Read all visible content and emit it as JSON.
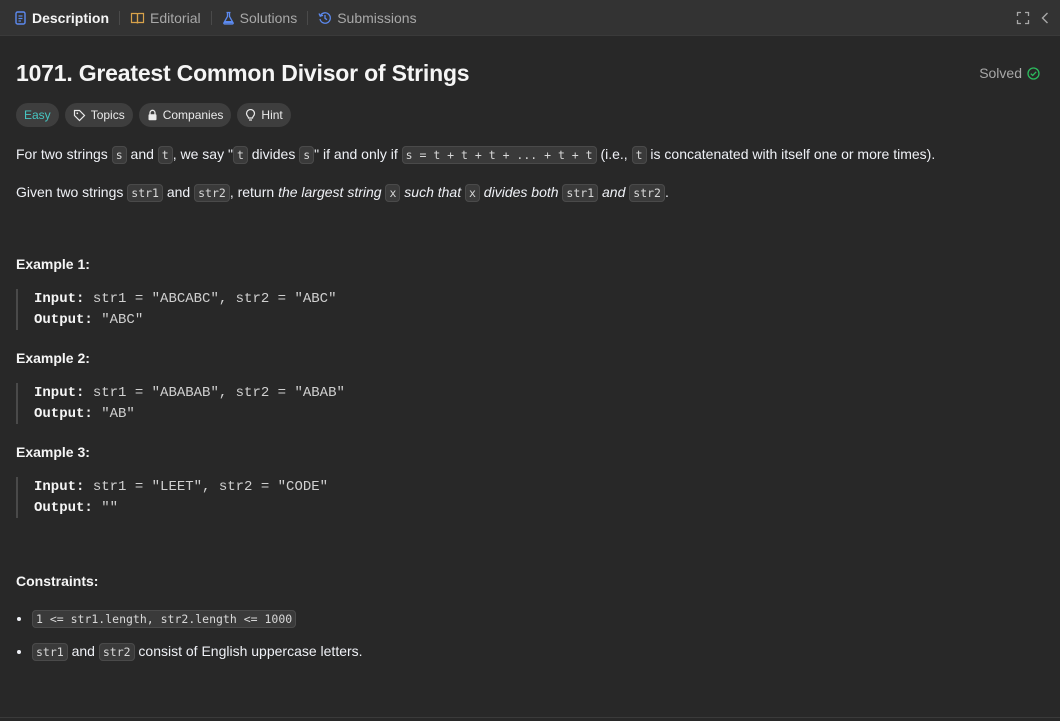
{
  "tabs": [
    {
      "label": "Description",
      "icon": "document-icon",
      "active": true
    },
    {
      "label": "Editorial",
      "icon": "book-icon"
    },
    {
      "label": "Solutions",
      "icon": "flask-icon"
    },
    {
      "label": "Submissions",
      "icon": "history-icon"
    }
  ],
  "problem": {
    "title": "1071. Greatest Common Divisor of Strings",
    "status": "Solved",
    "difficulty": "Easy",
    "chips": [
      "Topics",
      "Companies",
      "Hint"
    ]
  },
  "description": {
    "p1": {
      "a": "For two strings ",
      "s": "s",
      "b": " and ",
      "t": "t",
      "c": ", we say \"",
      "t2": "t",
      "d": " divides ",
      "s2": "s",
      "e": "\" if and only if ",
      "eq": "s = t + t + t + ... + t + t",
      "f": " (i.e., ",
      "t3": "t",
      "g": " is concatenated with itself one or more times)."
    },
    "p2": {
      "a": "Given two strings ",
      "str1": "str1",
      "b": " and ",
      "str2": "str2",
      "c": ", return ",
      "d": "the largest string ",
      "x": "x",
      "e": " such that ",
      "x2": "x",
      "f": " divides both ",
      "str1b": "str1",
      "g": " and ",
      "str2b": "str2",
      "h": "."
    }
  },
  "examples": [
    {
      "title": "Example 1:",
      "input_label": "Input:",
      "input": "str1 = \"ABCABC\", str2 = \"ABC\"",
      "output_label": "Output:",
      "output": "\"ABC\""
    },
    {
      "title": "Example 2:",
      "input_label": "Input:",
      "input": "str1 = \"ABABAB\", str2 = \"ABAB\"",
      "output_label": "Output:",
      "output": "\"AB\""
    },
    {
      "title": "Example 3:",
      "input_label": "Input:",
      "input": "str1 = \"LEET\", str2 = \"CODE\"",
      "output_label": "Output:",
      "output": "\"\""
    }
  ],
  "constraints": {
    "title": "Constraints:",
    "c1": "1 <= str1.length, str2.length <= 1000",
    "c2_code1": "str1",
    "c2_mid": " and ",
    "c2_code2": "str2",
    "c2_rest": " consist of English uppercase letters."
  },
  "colors": {
    "easy": "#46c6c2",
    "solved": "#2cbb5d",
    "accent": "#5c8af0"
  }
}
